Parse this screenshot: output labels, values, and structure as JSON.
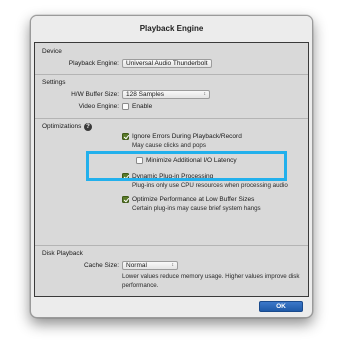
{
  "window": {
    "title": "Playback Engine"
  },
  "device": {
    "title": "Device",
    "playback_engine_label": "Playback Engine:",
    "playback_engine_value": "Universal Audio Thunderbolt"
  },
  "settings": {
    "title": "Settings",
    "hw_buffer_label": "H/W Buffer Size:",
    "hw_buffer_value": "128 Samples",
    "video_engine_label": "Video Engine:",
    "video_engine_enable_label": "Enable",
    "video_engine_enabled": false
  },
  "optimizations": {
    "title": "Optimizations",
    "help_icon": "?",
    "ignore_errors": {
      "label": "Ignore Errors During Playback/Record",
      "checked": true,
      "desc": "May cause clicks and pops"
    },
    "minimize_io": {
      "label": "Minimize Additional I/O Latency",
      "checked": false
    },
    "dynamic_plugin": {
      "label": "Dynamic Plug-in Processing",
      "checked": true,
      "desc": "Plug-ins only use CPU resources when processing audio"
    },
    "optimize_low_buffer": {
      "label": "Optimize Performance at Low Buffer Sizes",
      "checked": true,
      "desc": "Certain plug-ins may cause brief system hangs"
    }
  },
  "disk_playback": {
    "title": "Disk Playback",
    "cache_size_label": "Cache Size:",
    "cache_size_value": "Normal",
    "desc": "Lower values reduce memory usage. Higher values improve disk performance."
  },
  "footer": {
    "ok_label": "OK"
  },
  "colors": {
    "highlight": "#22b0ec",
    "ok_button": "#2a66b8",
    "checkbox_checked": "#5a7a2a"
  }
}
